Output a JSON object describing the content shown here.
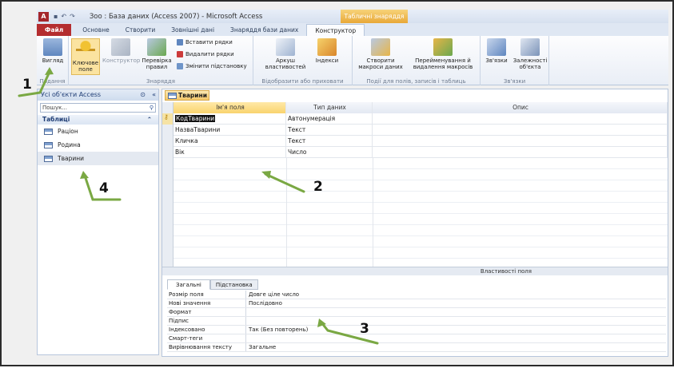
{
  "window": {
    "app_icon": "A",
    "title": "Зоо : База даних (Access 2007) - Microsoft Access",
    "contextual_tab": "Табличні знаряддя",
    "qat": [
      "save-icon",
      "undo-icon",
      "redo-icon"
    ]
  },
  "ribbon_tabs": [
    "Файл",
    "Основне",
    "Створити",
    "Зовнішні дані",
    "Знаряддя бази даних",
    "Конструктор"
  ],
  "ribbon": {
    "view_label": "Вигляд",
    "view_group": "Подання",
    "key_label": "Ключове поле",
    "builder_label": "Конструктор",
    "validate_label": "Перевірка правил",
    "insert_rows": "Вставити рядки",
    "delete_rows": "Видалити рядки",
    "modify_lookup": "Змінити підстановку",
    "tools_group": "Знаряддя",
    "property_sheet": "Аркуш властивостей",
    "indexes": "Індекси",
    "showhide_group": "Відобразити або приховати",
    "create_macros": "Створити макроси даних",
    "rename_macros": "Перейменування й видалення макросів",
    "events_group": "Події для полів, записів і таблиць",
    "relationships": "Зв'язки",
    "dependencies": "Залежності об'єкта",
    "relations_group": "Зв'язки"
  },
  "nav": {
    "header": "Усі об'єкти Access",
    "search_placeholder": "Пошук...",
    "group": "Таблиці",
    "items": [
      "Раціон",
      "Родина",
      "Тварини"
    ]
  },
  "document": {
    "tab_label": "Тварини",
    "col_headers": [
      "Ім'я поля",
      "Тип даних",
      "Опис"
    ],
    "rows": [
      {
        "field": "КодТварини",
        "type": "Автонумерація"
      },
      {
        "field": "НазваТварини",
        "type": "Текст"
      },
      {
        "field": "Кличка",
        "type": "Текст"
      },
      {
        "field": "Вік",
        "type": "Число"
      }
    ],
    "props_title": "Властивості поля",
    "prop_tabs": [
      "Загальні",
      "Підстановка"
    ],
    "props": [
      {
        "name": "Розмір поля",
        "value": "Довге ціле число"
      },
      {
        "name": "Нові значення",
        "value": "Послідовно"
      },
      {
        "name": "Формат",
        "value": ""
      },
      {
        "name": "Підпис",
        "value": ""
      },
      {
        "name": "Індексовано",
        "value": "Так (Без повторень)"
      },
      {
        "name": "Смарт-теги",
        "value": ""
      },
      {
        "name": "Вирівнювання тексту",
        "value": "Загальне"
      }
    ]
  },
  "callouts": [
    "1",
    "2",
    "3",
    "4"
  ],
  "colors": {
    "arrow": "#7aa843",
    "file_tab": "#b42d2f",
    "active_cell": "#f9d36e"
  }
}
